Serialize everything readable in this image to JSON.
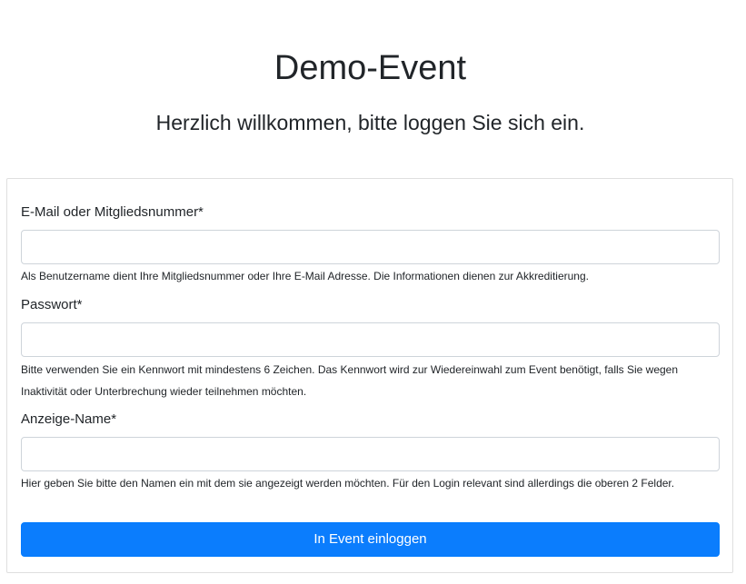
{
  "header": {
    "title": "Demo-Event",
    "subtitle": "Herzlich willkommen, bitte loggen Sie sich ein."
  },
  "form": {
    "email": {
      "label": "E-Mail oder Mitgliedsnummer*",
      "value": "",
      "placeholder": "",
      "help": "Als Benutzername dient Ihre Mitgliedsnummer oder Ihre E-Mail Adresse. Die Informationen dienen zur Akkreditierung."
    },
    "password": {
      "label": "Passwort*",
      "value": "",
      "placeholder": "",
      "help": "Bitte verwenden Sie ein Kennwort mit mindestens 6 Zeichen. Das Kennwort wird zur Wiedereinwahl zum Event benötigt, falls Sie wegen Inaktivität oder Unterbrechung wieder teilnehmen möchten."
    },
    "display_name": {
      "label": "Anzeige-Name*",
      "value": "",
      "placeholder": "",
      "help": "Hier geben Sie bitte den Namen ein mit dem sie angezeigt werden möchten. Für den Login relevant sind allerdings die oberen 2 Felder."
    },
    "submit_label": "In Event einloggen"
  },
  "colors": {
    "primary": "#0b7dfd",
    "text": "#212529",
    "border": "#ced4da"
  }
}
